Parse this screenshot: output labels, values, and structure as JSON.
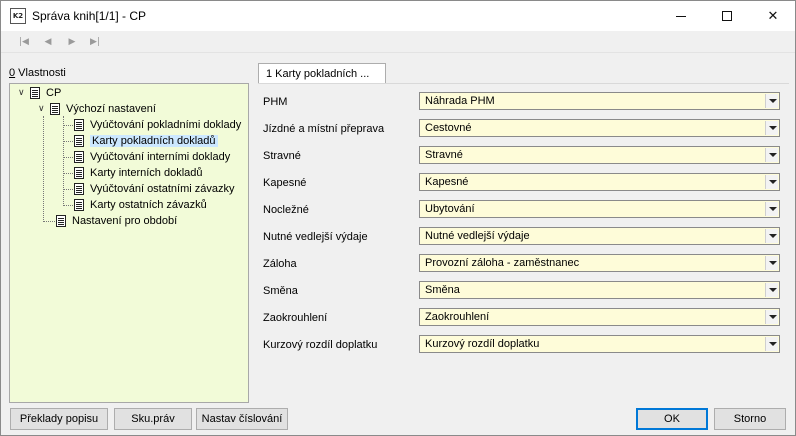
{
  "window": {
    "title": "Správa knih[1/1] - CP"
  },
  "panel": {
    "label_accel": "0",
    "label_rest": " Vlastnosti"
  },
  "tree": {
    "root": "CP",
    "group": "Výchozí nastavení",
    "children": [
      "Vyúčtování pokladními doklady",
      "Karty pokladních dokladů",
      "Vyúčtování interními doklady",
      "Karty interních dokladů",
      "Vyúčtování ostatními závazky",
      "Karty ostatních závazků"
    ],
    "selected_index": 1,
    "period": "Nastavení pro období"
  },
  "tab": {
    "label": "1 Karty pokladních ..."
  },
  "fields": [
    {
      "label": "PHM",
      "value": "Náhrada PHM"
    },
    {
      "label": "Jízdné a místní přeprava",
      "value": "Cestovné"
    },
    {
      "label": "Stravné",
      "value": "Stravné"
    },
    {
      "label": "Kapesné",
      "value": "Kapesné"
    },
    {
      "label": "Nocležné",
      "value": "Ubytování"
    },
    {
      "label": "Nutné vedlejší výdaje",
      "value": "Nutné vedlejší výdaje"
    },
    {
      "label": "Záloha",
      "value": "Provozní záloha - zaměstnanec"
    },
    {
      "label": "Směna",
      "value": "Směna"
    },
    {
      "label": "Zaokrouhlení",
      "value": "Zaokrouhlení"
    },
    {
      "label": "Kurzový rozdíl doplatku",
      "value": "Kurzový rozdíl doplatku"
    }
  ],
  "buttons": {
    "preklady": "Překlady popisu",
    "skupravy": "Sku.práv",
    "cislovani": "Nastav číslování",
    "ok": "OK",
    "storno": "Storno"
  },
  "colors": {
    "tree_bg": "#f2fbd8",
    "field_bg": "#fefcd9",
    "selection": "#cce8ff",
    "accent": "#0078d7"
  }
}
